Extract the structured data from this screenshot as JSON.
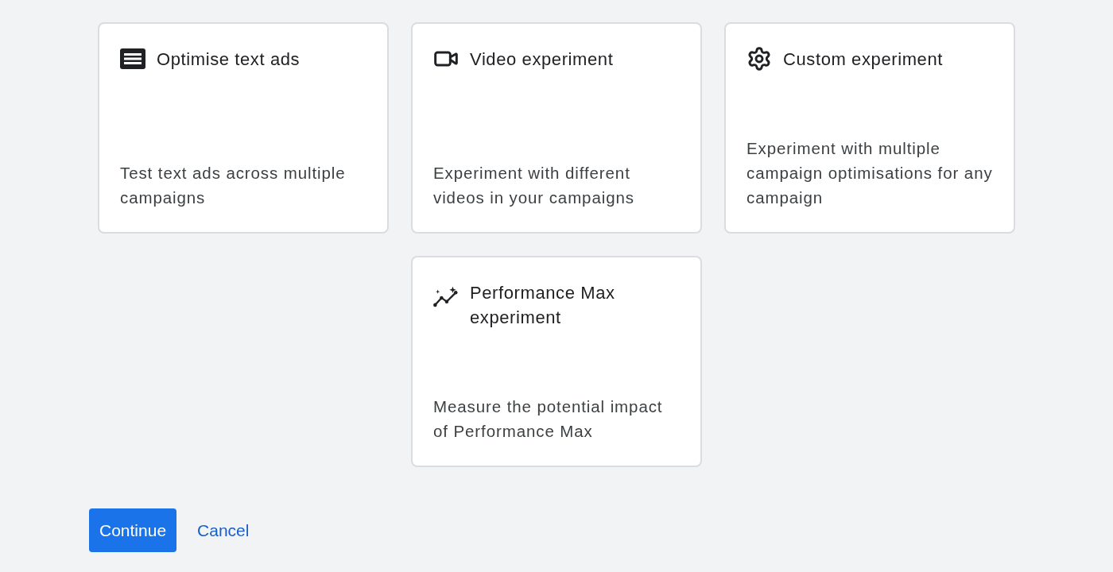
{
  "cards": [
    {
      "kind": "text-ads",
      "title": "Optimise text ads",
      "description": "Test text ads across multiple campaigns"
    },
    {
      "kind": "video",
      "title": "Video experiment",
      "description": "Experiment with different videos in your campaigns"
    },
    {
      "kind": "gear",
      "title": "Custom experiment",
      "description": "Experiment with multiple campaign optimisations for any campaign"
    },
    {
      "kind": "sparkle-chart",
      "title": "Performance Max experiment",
      "description": "Measure the potential impact of Performance Max"
    }
  ],
  "buttons": {
    "primary": "Continue",
    "secondary": "Cancel"
  }
}
